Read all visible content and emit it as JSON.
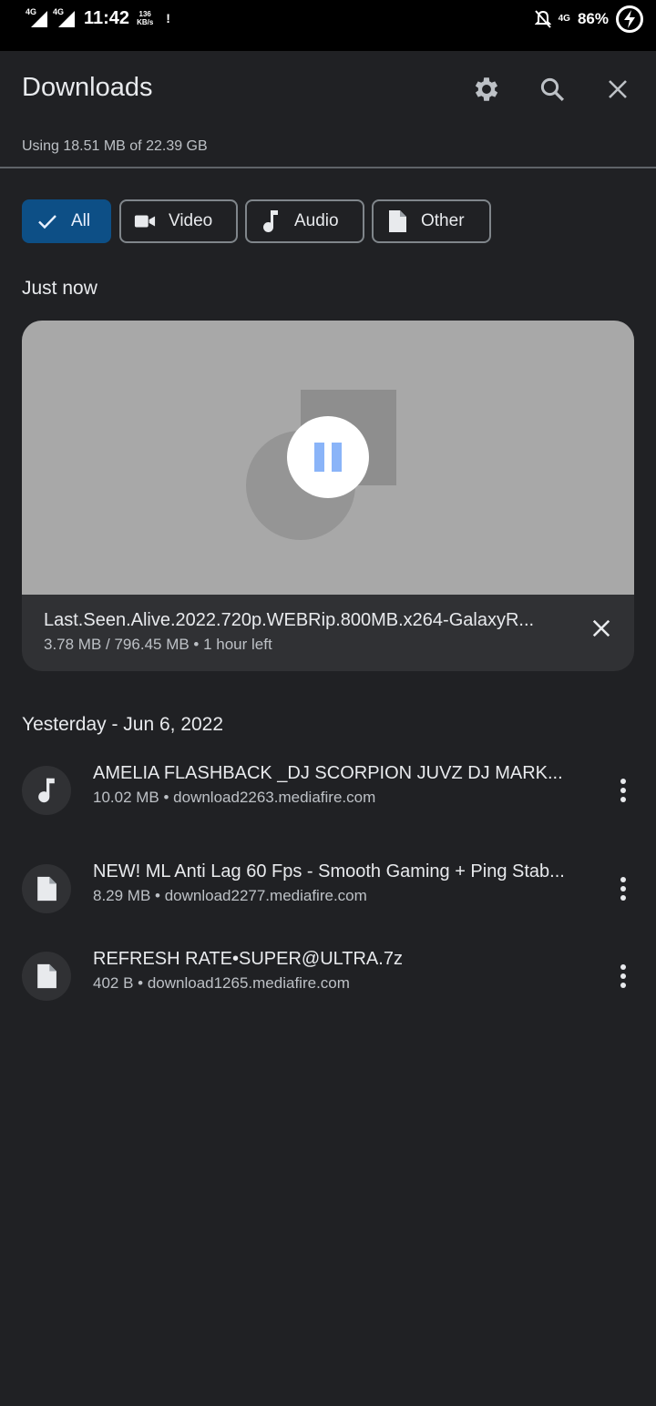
{
  "status_bar": {
    "sim1": "4G",
    "sim2": "4G",
    "time": "11:42",
    "speed_value": "136",
    "speed_unit": "KB/s",
    "alert": "!",
    "network": "4G",
    "battery": "86%"
  },
  "header": {
    "title": "Downloads",
    "storage_text": "Using 18.51 MB of 22.39 GB"
  },
  "filters": [
    {
      "label": "All",
      "icon": "check-icon",
      "active": true
    },
    {
      "label": "Video",
      "icon": "video-camera-icon",
      "active": false
    },
    {
      "label": "Audio",
      "icon": "music-note-icon",
      "active": false
    },
    {
      "label": "Other",
      "icon": "document-icon",
      "active": false
    }
  ],
  "sections": {
    "just_now": "Just now",
    "yesterday": "Yesterday - Jun 6, 2022"
  },
  "active_download": {
    "name": "Last.Seen.Alive.2022.720p.WEBRip.800MB.x264-GalaxyR...",
    "meta": "3.78 MB / 796.45 MB • 1 hour left",
    "downloaded_mb": 3.78,
    "total_mb": 796.45,
    "state": "paused"
  },
  "items": [
    {
      "name": "AMELIA FLASHBACK _DJ SCORPION JUVZ DJ MARK...",
      "meta": "10.02 MB • download2263.mediafire.com",
      "icon": "music-note-icon"
    },
    {
      "name": "NEW! ML Anti Lag 60 Fps - Smooth Gaming + Ping Stab...",
      "meta": "8.29 MB • download2277.mediafire.com",
      "icon": "document-icon"
    },
    {
      "name": "REFRESH RATE•SUPER@ULTRA.7z",
      "meta": "402 B • download1265.mediafire.com",
      "icon": "document-icon"
    }
  ],
  "colors": {
    "background": "#202124",
    "accent_chip": "#0d4f86",
    "accent_blue": "#8ab4f8"
  }
}
